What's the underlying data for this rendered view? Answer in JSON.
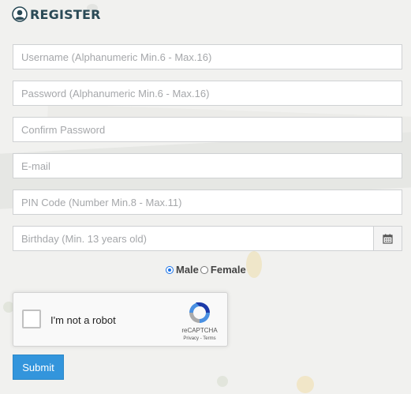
{
  "header": {
    "title": "REGISTER",
    "icon": "user-circle-icon"
  },
  "form": {
    "username": {
      "placeholder": "Username (Alphanumeric Min.6 - Max.16)",
      "value": ""
    },
    "password": {
      "placeholder": "Password (Alphanumeric Min.6 - Max.16)",
      "value": ""
    },
    "confirm_password": {
      "placeholder": "Confirm Password",
      "value": ""
    },
    "email": {
      "placeholder": "E-mail",
      "value": ""
    },
    "pin": {
      "placeholder": "PIN Code (Number Min.8 - Max.11)",
      "value": ""
    },
    "birthday": {
      "placeholder": "Birthday (Min. 13 years old)",
      "value": "",
      "icon": "calendar-icon"
    },
    "gender": {
      "options": [
        "Male",
        "Female"
      ],
      "selected": "Male"
    },
    "recaptcha": {
      "label": "I'm not a robot",
      "brand": "reCAPTCHA",
      "links": "Privacy - Terms"
    },
    "submit_label": "Submit"
  },
  "colors": {
    "accent": "#3395dc",
    "title": "#2a4a56",
    "background": "#f1f1ef"
  }
}
